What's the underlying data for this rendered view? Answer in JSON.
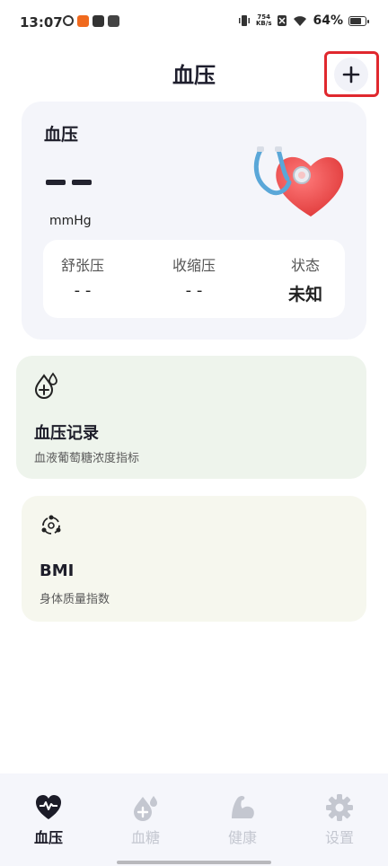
{
  "status_bar": {
    "time": "13:07",
    "net_speed_value": "754",
    "net_speed_unit": "KB/s",
    "battery_percent": "64%",
    "battery_level": 0.64
  },
  "header": {
    "title": "血压",
    "add_icon": "plus-icon"
  },
  "bp_card": {
    "title": "血压",
    "value_display": "--",
    "unit": "mmHg",
    "stats": [
      {
        "label": "舒张压",
        "value": "- -"
      },
      {
        "label": "收缩压",
        "value": "- -"
      },
      {
        "label": "状态",
        "value": "未知"
      }
    ]
  },
  "feature_cards": [
    {
      "icon": "drop-plus-icon",
      "title": "血压记录",
      "subtitle": "血液葡萄糖浓度指标",
      "background": "#eef4ec"
    },
    {
      "icon": "bmi-cycle-icon",
      "title": "BMI",
      "subtitle": "身体质量指数",
      "background": "#f6f7ee"
    }
  ],
  "bottom_nav": {
    "items": [
      {
        "label": "血压",
        "icon": "heart-pulse-icon",
        "active": true
      },
      {
        "label": "血糖",
        "icon": "drop-plus-icon",
        "active": false
      },
      {
        "label": "健康",
        "icon": "muscle-arm-icon",
        "active": false
      },
      {
        "label": "设置",
        "icon": "gear-icon",
        "active": false
      }
    ]
  },
  "colors": {
    "accent_dark": "#1c1c28",
    "inactive_nav": "#c4c7d0",
    "highlight_border": "#e0282e"
  }
}
